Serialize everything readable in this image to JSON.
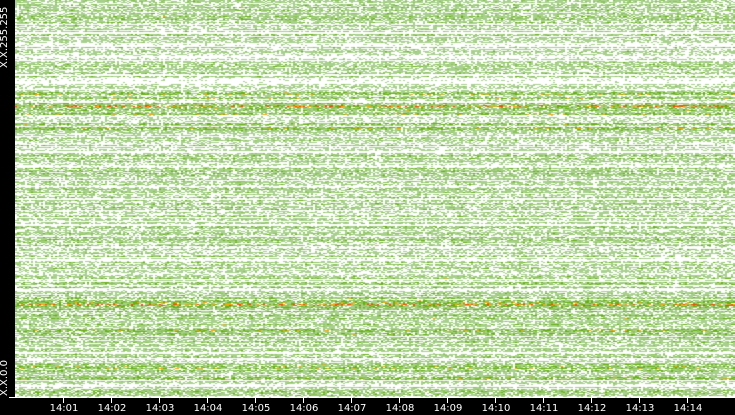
{
  "chart_data": {
    "type": "heatmap",
    "title": "",
    "xlabel": "",
    "ylabel": "",
    "x_ticks": [
      "14:01",
      "14:02",
      "14:03",
      "14:04",
      "14:05",
      "14:06",
      "14:07",
      "14:08",
      "14:09",
      "14:10",
      "14:11",
      "14:12",
      "14:13",
      "14:14"
    ],
    "y_labels": {
      "top": "X.X.255.255",
      "bottom": "X.X.0.0"
    },
    "color_scale": [
      "#ffffff",
      "#a8d08d",
      "#8cc45a",
      "#66b010",
      "#ffa500",
      "#ff4500",
      "#e00000"
    ],
    "description_bands": [
      "dense high-activity rows near top third and around lower third"
    ]
  }
}
